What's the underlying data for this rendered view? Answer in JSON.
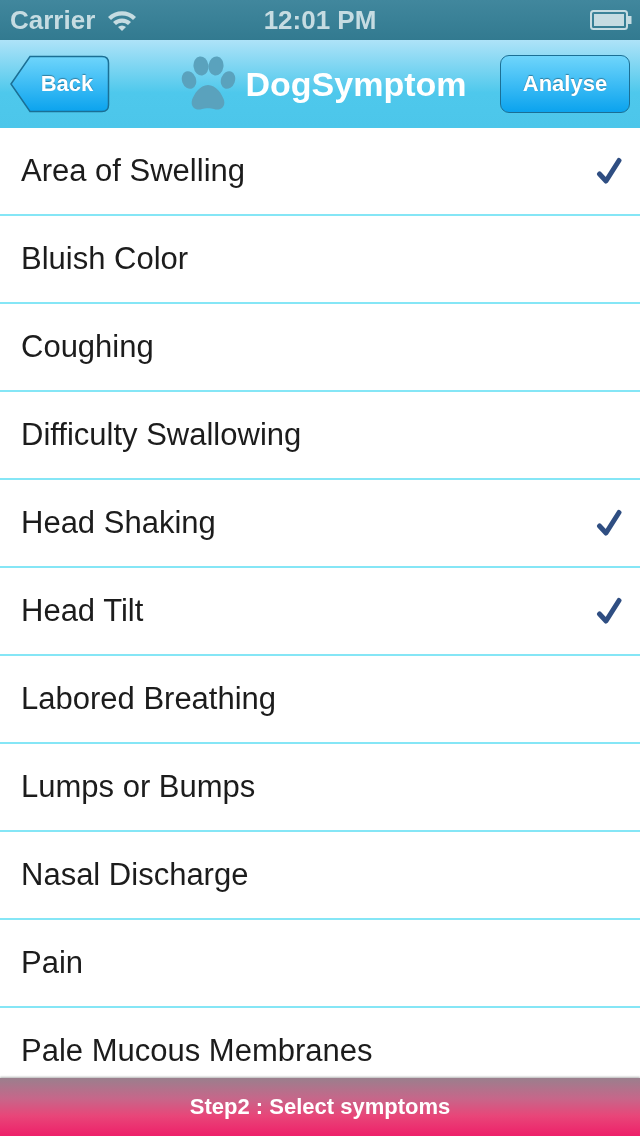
{
  "status_bar": {
    "carrier": "Carrier",
    "time": "12:01 PM"
  },
  "nav_bar": {
    "back_button": "Back",
    "title": "DogSymptom",
    "action_button": "Analyse"
  },
  "symptoms": [
    {
      "label": "Area of Swelling",
      "checked": true
    },
    {
      "label": "Bluish Color",
      "checked": false
    },
    {
      "label": "Coughing",
      "checked": false
    },
    {
      "label": "Difficulty Swallowing",
      "checked": false
    },
    {
      "label": "Head Shaking",
      "checked": true
    },
    {
      "label": "Head Tilt",
      "checked": true
    },
    {
      "label": "Labored Breathing",
      "checked": false
    },
    {
      "label": "Lumps or Bumps",
      "checked": false
    },
    {
      "label": "Nasal Discharge",
      "checked": false
    },
    {
      "label": "Pain",
      "checked": false
    },
    {
      "label": "Pale Mucous Membranes",
      "checked": false
    }
  ],
  "footer": {
    "text": "Step2 : Select symptoms"
  }
}
